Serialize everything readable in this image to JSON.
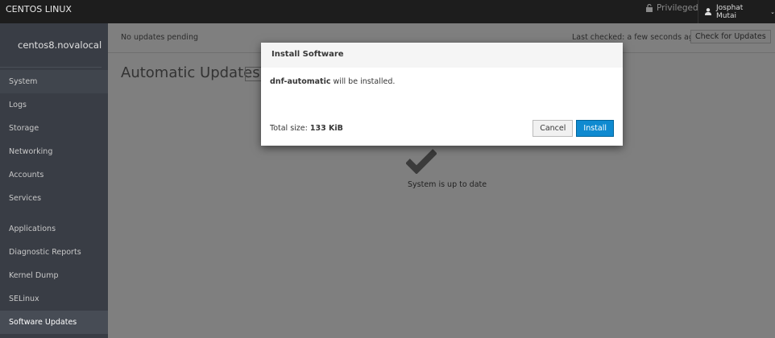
{
  "topbar": {
    "brand": "CENTOS LINUX",
    "privileged": "Privileged",
    "user": "Josphat Mutai"
  },
  "sidebar": {
    "host": "centos8.novalocal",
    "items": [
      {
        "label": "System"
      },
      {
        "label": "Logs"
      },
      {
        "label": "Storage"
      },
      {
        "label": "Networking"
      },
      {
        "label": "Accounts"
      },
      {
        "label": "Services"
      },
      {
        "label": "Applications"
      },
      {
        "label": "Diagnostic Reports"
      },
      {
        "label": "Kernel Dump"
      },
      {
        "label": "SELinux"
      },
      {
        "label": "Software Updates"
      }
    ]
  },
  "main": {
    "status": "No updates pending",
    "last_checked": "Last checked: a few seconds ago",
    "check_button": "Check for Updates",
    "auto_heading": "Automatic Updates",
    "up_to_date": "System is up to date"
  },
  "modal": {
    "title": "Install Software",
    "package": "dnf-automatic",
    "body_suffix": " will be installed.",
    "total_label": "Total size: ",
    "total_value": "133 KiB",
    "cancel": "Cancel",
    "install": "Install"
  }
}
